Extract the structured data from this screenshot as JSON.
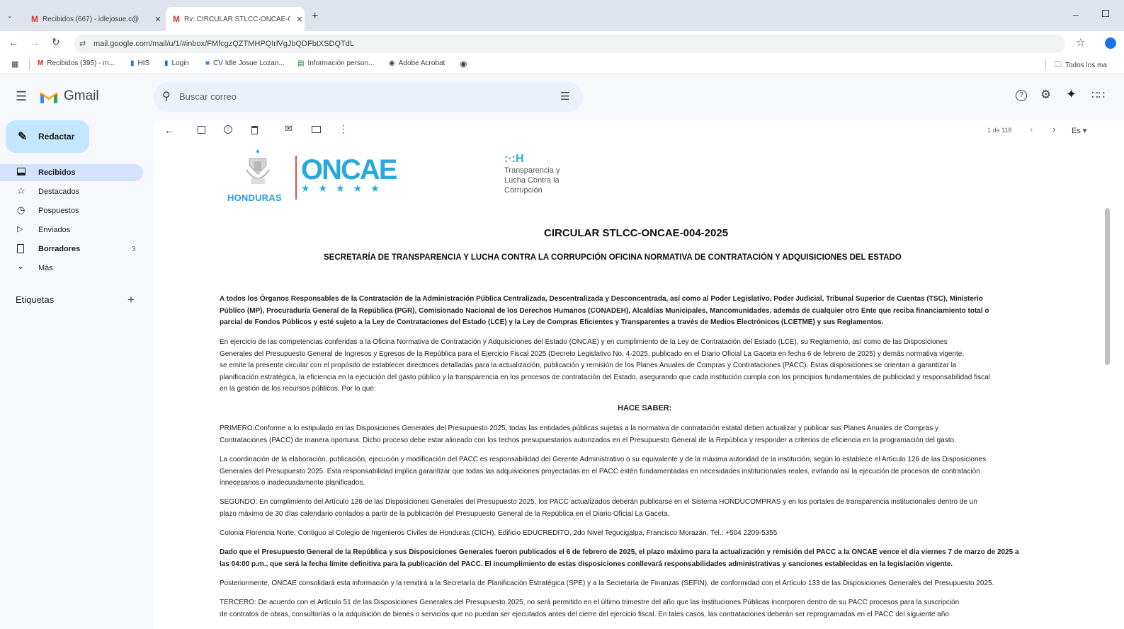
{
  "browser": {
    "tabs": [
      {
        "label": "Recibidos (667) - idlejosue.c@",
        "active": false
      },
      {
        "label": "Rv: CIRCULAR STLCC-ONCAE-0",
        "active": true
      }
    ],
    "url": "mail.google.com/mail/u/1/#inbox/FMfcgzQZTMHPQIrlVgJbQDFbtXSDQTdL",
    "bookmarks": [
      "Recibidos (395) - m...",
      "HIS",
      "Login",
      "CV Idle Josue Lozan...",
      "Información person...",
      "Adobe Acrobat",
      "Todos los ma"
    ]
  },
  "gmail": {
    "app_name": "Gmail",
    "search_placeholder": "Buscar correo",
    "compose_label": "Redactar",
    "nav": [
      {
        "label": "Recibidos",
        "icon": "inbox-icon",
        "active": true,
        "count": ""
      },
      {
        "label": "Destacados",
        "icon": "star-icon",
        "active": false,
        "count": ""
      },
      {
        "label": "Pospuestos",
        "icon": "clock-icon",
        "active": false,
        "count": ""
      },
      {
        "label": "Enviados",
        "icon": "send-icon",
        "active": false,
        "count": ""
      },
      {
        "label": "Borradores",
        "icon": "draft-icon",
        "active": false,
        "count": "3"
      },
      {
        "label": "Más",
        "icon": "chevron-down-icon",
        "active": false,
        "count": ""
      }
    ],
    "labels_heading": "Etiquetas",
    "pager": "1 de 118",
    "lang": "Es"
  },
  "email": {
    "logo_country": "HONDURAS",
    "logo_oncae": "ONCAE",
    "logo_tlc": [
      "Transparencia y",
      "Lucha Contra la",
      "Corrupción"
    ],
    "title": "CIRCULAR STLCC-ONCAE-004-2025",
    "subtitle": "SECRETARÍA DE TRANSPARENCIA Y LUCHA CONTRA LA CORRUPCIÓN OFICINA NORMATIVA DE CONTRATACIÓN Y ADQUISICIONES DEL ESTADO",
    "p1": [
      "A todos los Órganos Responsables de la Contratación de la Administración Pública Centralizada, Descentralizada y Desconcentrada, así como al Poder Legislativo, Poder Judicial, Tribunal Superior de Cuentas (TSC), Ministerio",
      "Público (MP), Procuraduría General de la República (PGR), Comisionado Nacional de los Derechos Humanos (CONADEH), Alcaldías Municipales, Mancomunidades, además de cualquier otro Ente que reciba financiamiento total o",
      "parcial de Fondos Públicos y esté sujeto a la Ley de Contrataciones del Estado (LCE) y la Ley de Compras Eficientes y Transparentes a través de Medios Electrónicos (LCETME) y sus Reglamentos."
    ],
    "p2": [
      "En ejercicio de las competencias conferidas a la Oficina Normativa de Contratación y Adquisiciones del Estado (ONCAE) y en cumplimiento de la Ley de Contratación del Estado (LCE), su Reglamento, así como de las Disposiciones",
      "Generales del Presupuesto General de Ingresos y Egresos de la República para el Ejercicio Fiscal 2025 (Decreto Legislativo No. 4-2025, publicado en el Diario Oficial La Gaceta en fecha 6 de febrero de 2025) y demás normativa vigente,",
      "se emite la presente circular con el propósito de establecer directrices detalladas para la actualización, publicación y remisión de los Planes Anuales de Compras y Contrataciones (PACC). Estas disposiciones se orientan a garantizar la",
      "planificación estratégica, la eficiencia en la ejecución del gasto público y la transparencia en los procesos de contratación del Estado, asegurando que cada institución cumpla con los principios fundamentales de publicidad y responsabilidad fiscal",
      "en la gestión de los recursos públicos. Por lo que:"
    ],
    "hace_saber": "HACE SABER:",
    "p3": [
      "PRIMERO:Conforme a lo estipulado en las Disposiciones Generales del Presupuesto 2025, todas las entidades públicas sujetas a la normativa de contratación estatal deben actualizar y publicar sus Planes Anuales de Compras y",
      "Contrataciones (PACC) de manera oportuna. Dicho proceso debe estar alineado con los techos presupuestarios autorizados en el Presupuesto General de la República y responder a criterios de eficiencia en la programación del gasto."
    ],
    "p4": [
      "La coordinación de la elaboración, publicación, ejecución y modificación del PACC es responsabilidad del Gerente Administrativo o su equivalente y de la máxima autoridad de la institución, según lo establece el Artículo 126 de las Disposiciones",
      "Generales del Presupuesto 2025. Esta responsabilidad implica garantizar que todas las adquisiciones proyectadas en el PACC estén fundamentadas en necesidades institucionales reales, evitando así la ejecución de procesos de contratación",
      "innecesarios o inadecuadamente planificados."
    ],
    "p5": [
      "SEGUNDO: En cumplimiento del Artículo 126 de las Disposiciones Generales del Presupuesto 2025, los PACC actualizados deberán publicarse en el Sistema HONDUCOMPRAS y en los portales de transparencia institucionales dentro de un",
      "plazo máximo de 30 días calendario contados a partir de la publicación del Presupuesto General de la República en el Diario Oficial La Gaceta."
    ],
    "p6": "Colonia Florencia Norte, Contiguo al Colegio de Ingenieros Civiles de Honduras (CICH), Edificio EDUCREDITO, 2do Nivel Tegucigalpa, Francisco Morazán. Tel.: +504 2209-5355",
    "p7": [
      "Dado que el Presupuesto General de la República y sus Disposiciones Generales fueron publicados el 6 de febrero de 2025, el plazo máximo para la actualización y remisión del PACC a la ONCAE vence el día viernes 7 de marzo de 2025 a",
      "las 04:00 p.m., que será la fecha límite definitiva para la publicación del PACC. El incumplimiento de estas disposiciones conllevará responsabilidades administrativas y sanciones establecidas en la legislación vigente."
    ],
    "p8": "Posteriormente, ONCAE consolidará esta información y la remitirá a la Secretaría de Planificación Estratégica (SPE) y a la Secretaría de Finanzas (SEFIN), de conformidad con el Artículo 133 de las Disposiciones Generales del Presupuesto 2025.",
    "p9": [
      "TERCERO: De acuerdo con el Artículo 51 de las Disposiciones Generales del Presupuesto 2025, no será permitido en el último trimestre del año que las Instituciones Públicas incorporen dentro de su PACC procesos para la suscripción",
      "de contratos de obras, consultorías o la adquisición de bienes o servicios que no puedan ser ejecutados antes del cierre del ejercicio fiscal. En tales casos, las contrataciones deberán ser reprogramadas en el PACC del siguiente año"
    ]
  },
  "colors": {
    "tabbar": "#dfe3eb",
    "compose": "#c2e7ff",
    "active_nav": "#d3e3fd",
    "search": "#eaf1fb",
    "gmail_red": "#ea4335",
    "oncae_blue": "#29a9d9"
  }
}
